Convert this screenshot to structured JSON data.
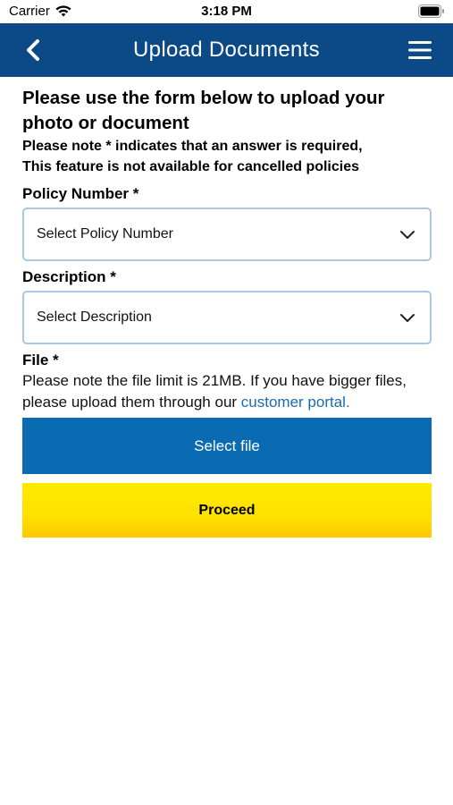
{
  "status_bar": {
    "carrier": "Carrier",
    "time": "3:18 PM"
  },
  "header": {
    "title": "Upload Documents",
    "color": "#0b4a86"
  },
  "intro": {
    "heading": "Please use the form below to upload your photo or document",
    "note_line1": "Please note * indicates that an answer is required,",
    "note_line2": "This feature is not available for cancelled policies"
  },
  "policy_number": {
    "label": "Policy Number *",
    "selected": "Select Policy Number"
  },
  "description": {
    "label": "Description *",
    "selected": "Select Description"
  },
  "file": {
    "label": "File *",
    "note_text": "Please note the file limit is 21MB. If you have bigger files, please upload them through our ",
    "link_text": "customer portal.",
    "select_button": "Select file"
  },
  "proceed": {
    "label": "Proceed"
  },
  "colors": {
    "accent_blue": "#0b6bb2",
    "link": "#1a6bb0",
    "proceed_yellow": "#ffe100"
  },
  "icons": [
    "wifi-icon",
    "battery-icon",
    "back-arrow-icon",
    "menu-icon",
    "chevron-down-icon"
  ]
}
